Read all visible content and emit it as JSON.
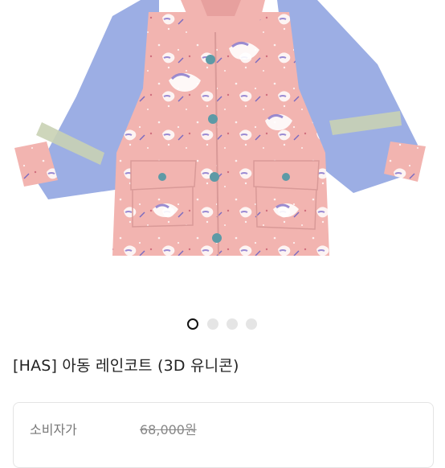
{
  "gallery": {
    "image_alt": "pink unicorn print children's raincoat with lavender sleeves",
    "dots": [
      {
        "active": true
      },
      {
        "active": false
      },
      {
        "active": false
      },
      {
        "active": false
      }
    ]
  },
  "product": {
    "title": "[HAS] 아동 레인코트 (3D 유니콘)"
  },
  "price": {
    "label": "소비자가",
    "value": "68,000원"
  },
  "colors": {
    "coat_pink": "#f3b7b3",
    "sleeve_lavender": "#9aaee3",
    "button_teal": "#5d9aa6",
    "reflective_band": "#c7d1b6"
  }
}
